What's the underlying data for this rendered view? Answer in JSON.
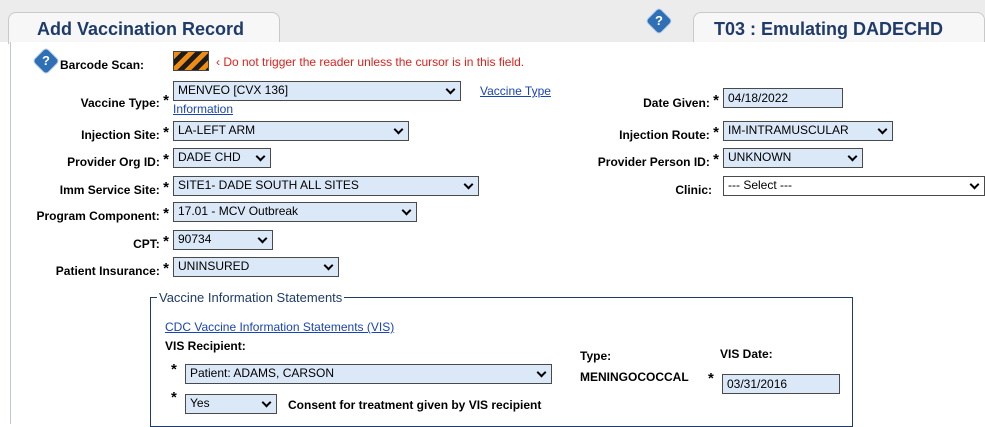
{
  "tabs": {
    "left_title": "Add Vaccination Record",
    "right_title": "T03 : Emulating DADECHD"
  },
  "icons": {
    "help": "help-icon",
    "barcode": "barcode-icon",
    "warning_arrow": "arrow-left-icon",
    "chevron": "chevron-down-icon"
  },
  "barcode": {
    "label": "Barcode Scan:",
    "warning": "‹ Do not trigger the reader unless the cursor is in this field."
  },
  "labels": {
    "vaccine_type": "Vaccine Type:",
    "injection_site": "Injection Site:",
    "provider_org": "Provider Org ID:",
    "imm_service_site": "Imm Service Site:",
    "program_component": "Program Component:",
    "cpt": "CPT:",
    "patient_insurance": "Patient Insurance:",
    "date_given": "Date Given:",
    "injection_route": "Injection Route:",
    "provider_person": "Provider Person ID:",
    "clinic": "Clinic:",
    "required": "*"
  },
  "values": {
    "vaccine_type": "MENVEO  [CVX 136]",
    "injection_site": "LA-LEFT ARM",
    "provider_org": "DADE CHD",
    "imm_service_site": "SITE1- DADE SOUTH ALL SITES",
    "program_component": "17.01 - MCV Outbreak",
    "cpt": "90734",
    "patient_insurance": "UNINSURED",
    "date_given": "04/18/2022",
    "injection_route": "IM-INTRAMUSCULAR",
    "provider_person": "UNKNOWN",
    "clinic": "--- Select ---"
  },
  "links": {
    "vaccine_type_info_1": "Vaccine Type",
    "vaccine_type_info_2": "Information",
    "cdc_vis": "CDC Vaccine Information Statements (VIS)"
  },
  "vis": {
    "legend": "Vaccine Information Statements",
    "recipient_label": "VIS Recipient:",
    "recipient_value": "Patient: ADAMS, CARSON",
    "type_label": "Type:",
    "type_value": "MENINGOCOCCAL",
    "date_label": "VIS Date:",
    "date_value": "03/31/2016",
    "consent_value": "Yes",
    "consent_label": "Consent for treatment given by VIS recipient"
  },
  "colors": {
    "title": "#1f3b6a",
    "field_bg": "#dbe8f8",
    "warning": "#e0211b",
    "link": "#1a43b5"
  }
}
